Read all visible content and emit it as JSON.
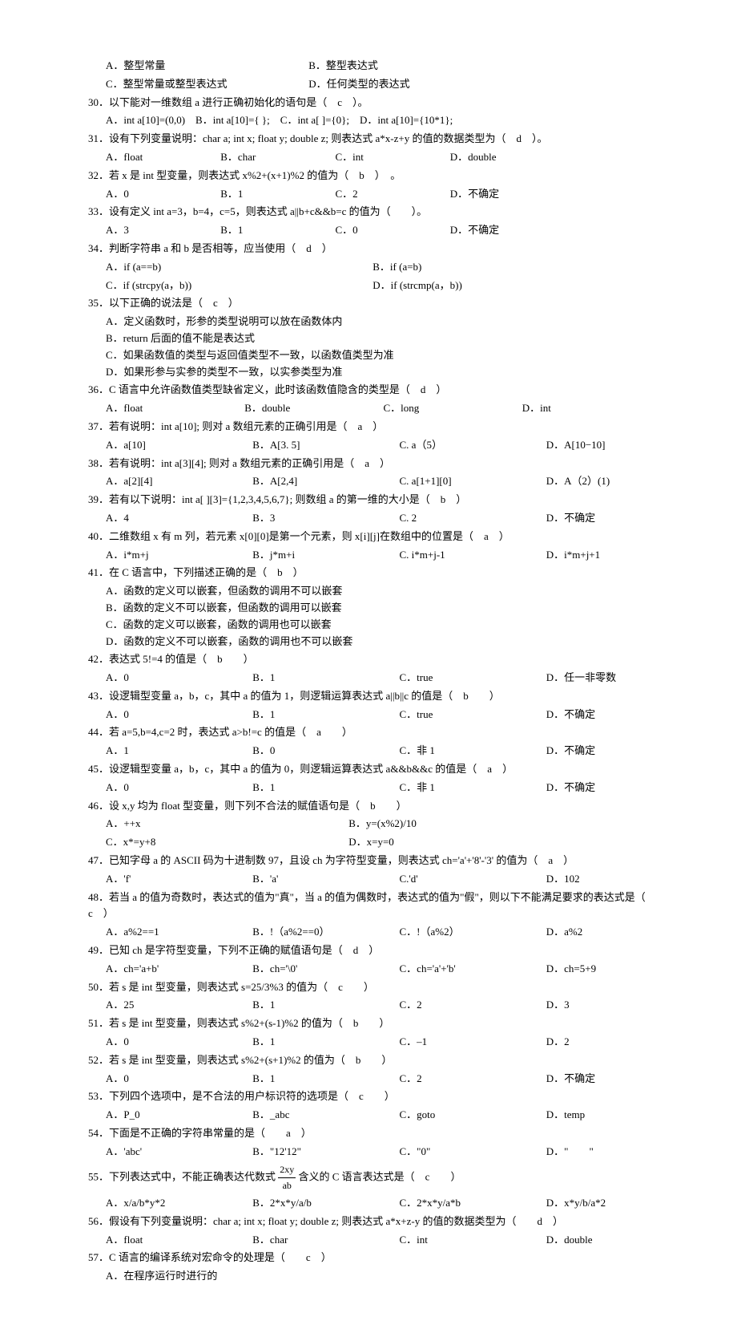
{
  "q29": {
    "optA": "A．整型常量",
    "optB": "B．整型表达式",
    "optC": "C．整型常量或整型表达式",
    "optD": "D．任何类型的表达式"
  },
  "q30": {
    "stem": "30．以下能对一维数组 a 进行正确初始化的语句是（　c　）。",
    "opts": "A．int a[10]=(0,0)　B．int a[10]={ };　C．int a[ ]={0};　D．int a[10]={10*1};"
  },
  "q31": {
    "stem": "31．设有下列变量说明：char a; int x; float y; double z;  则表达式 a*x-z+y 的值的数据类型为（　d　）。",
    "optA": "A．float",
    "optB": "B．char",
    "optC": "C．int",
    "optD": "D．double"
  },
  "q32": {
    "stem": "32．若 x 是 int 型变量，则表达式 x%2+(x+1)%2 的值为（　b　）　。",
    "optA": "A．0",
    "optB": "B．1",
    "optC": "C．2",
    "optD": "D．不确定"
  },
  "q33": {
    "stem": "33．设有定义 int a=3，b=4，c=5，则表达式 a||b+c&&b=c 的值为（　　）。",
    "optA": "A．3",
    "optB": "B．1",
    "optC": "C．0",
    "optD": "D．不确定"
  },
  "q34": {
    "stem": "34．判断字符串 a 和 b 是否相等，应当使用（　d　）",
    "optA": "A．if (a==b)",
    "optB": "B．if (a=b)",
    "optC": "C．if (strcpy(a，b))",
    "optD": "D．if (strcmp(a，b))"
  },
  "q35": {
    "stem": "35．以下正确的说法是（　c　）",
    "optA": "A．定义函数时，形参的类型说明可以放在函数体内",
    "optB": "B．return 后面的值不能是表达式",
    "optC": "C．如果函数值的类型与返回值类型不一致，以函数值类型为准",
    "optD": "D．如果形参与实参的类型不一致，以实参类型为准"
  },
  "q36": {
    "stem": "36．C 语言中允许函数值类型缺省定义，此时该函数值隐含的类型是（　d　）",
    "optA": "A．float",
    "optB": "B．double",
    "optC": "C．long",
    "optD": "D．int"
  },
  "q37": {
    "stem": "37．若有说明：int a[10];  则对 a 数组元素的正确引用是（　a　）",
    "optA": "A．a[10]",
    "optB": "B．A[3. 5]",
    "optC": "C. a（5）",
    "optD": "D．A[10−10]"
  },
  "q38": {
    "stem": "38．若有说明：int a[3][4];  则对 a 数组元素的正确引用是（　a　）",
    "optA": "A．a[2][4]",
    "optB": "B．A[2,4]",
    "optC": "C. a[1+1][0]",
    "optD": "D．A（2）(1)"
  },
  "q39": {
    "stem": "39．若有以下说明：int a[ ][3]={1,2,3,4,5,6,7};  则数组 a 的第一维的大小是（　b　）",
    "optA": "A．4",
    "optB": "B．3",
    "optC": "C. 2",
    "optD": "D．不确定"
  },
  "q40": {
    "stem": "40．二维数组 x 有 m 列，若元素 x[0][0]是第一个元素，则 x[i][j]在数组中的位置是（　a　）",
    "optA": "A．i*m+j",
    "optB": "B．j*m+i",
    "optC": "C. i*m+j-1",
    "optD": "D．i*m+j+1"
  },
  "q41": {
    "stem": "41．在 C 语言中，下列描述正确的是（　b　）",
    "optA": "A．函数的定义可以嵌套，但函数的调用不可以嵌套",
    "optB": "B．函数的定义不可以嵌套，但函数的调用可以嵌套",
    "optC": "C．函数的定义可以嵌套，函数的调用也可以嵌套",
    "optD": "D．函数的定义不可以嵌套，函数的调用也不可以嵌套"
  },
  "q42": {
    "stem": "42．表达式 5!=4 的值是（　b　　）",
    "optA": "A．0",
    "optB": "B．1",
    "optC": "C．true",
    "optD": "D．任一非零数"
  },
  "q43": {
    "stem": "43．设逻辑型变量 a，b，c，其中 a 的值为 1，则逻辑运算表达式 a||b||c 的值是（　b　　）",
    "optA": "A．0",
    "optB": "B．1",
    "optC": "C．true",
    "optD": "D．不确定"
  },
  "q44": {
    "stem": "44．若 a=5,b=4,c=2 时，表达式 a>b!=c 的值是（　a　　）",
    "optA": "A．1",
    "optB": "B．0",
    "optC": "C．非 1",
    "optD": "D．不确定"
  },
  "q45": {
    "stem": "45．设逻辑型变量 a，b，c，其中 a 的值为 0，则逻辑运算表达式 a&&b&&c 的值是（　a　）",
    "optA": "A．0",
    "optB": "B．1",
    "optC": "C．非 1",
    "optD": "D．不确定"
  },
  "q46": {
    "stem": "46．设 x,y 均为 float 型变量，则下列不合法的赋值语句是（　b　　）",
    "optA": "A．++x",
    "optB": "B．y=(x%2)/10",
    "optC": "C．x*=y+8",
    "optD": "D．x=y=0"
  },
  "q47": {
    "stem": "47．已知字母 a 的 ASCII 码为十进制数 97，且设 ch 为字符型变量，则表达式 ch='a'+'8'-'3' 的值为（　a　）",
    "optA": "A．'f'",
    "optB": "B．'a'",
    "optC": "C.'d'",
    "optD": "D．102"
  },
  "q48": {
    "stem": "48．若当 a 的值为奇数时，表达式的值为\"真\"，当 a 的值为偶数时，表达式的值为\"假\"，则以下不能满足要求的表达式是（　c　）",
    "optA": "A．a%2==1",
    "optB": "B．!（a%2==0）",
    "optC": "C．!（a%2）",
    "optD": "D．a%2"
  },
  "q49": {
    "stem": "49．已知 ch 是字符型变量，下列不正确的赋值语句是（　d　）",
    "optA": "A．ch='a+b'",
    "optB": "B．ch='\\0'",
    "optC": "C．ch='a'+'b'",
    "optD": "D．ch=5+9"
  },
  "q50": {
    "stem": "50．若 s 是 int 型变量，则表达式 s=25/3%3 的值为（　c　　）",
    "optA": "A．25",
    "optB": "B．1",
    "optC": "C．2",
    "optD": "D．3"
  },
  "q51": {
    "stem": "51．若 s 是 int 型变量，则表达式 s%2+(s-1)%2 的值为（　b　　）",
    "optA": "A．0",
    "optB": "B．1",
    "optC": "C．–1",
    "optD": "D．2"
  },
  "q52": {
    "stem": "52．若 s 是 int 型变量，则表达式 s%2+(s+1)%2 的值为（　b　　）",
    "optA": "A．0",
    "optB": "B．1",
    "optC": "C．2",
    "optD": "D．不确定"
  },
  "q53": {
    "stem": "53．下列四个选项中，是不合法的用户标识符的选项是（　c　　）",
    "optA": "A．P_0",
    "optB": "B．_abc",
    "optC": "C．goto",
    "optD": "D．temp"
  },
  "q54": {
    "stem": "54．下面是不正确的字符串常量的是（　　a　）",
    "optA": "A．'abc'",
    "optB": "B．\"12'12\"",
    "optC": "C．\"0\"",
    "optD": "D．\"　　\""
  },
  "q55": {
    "stemPre": "55．下列表达式中，不能正确表达代数式 ",
    "fracN": "2xy",
    "fracD": "ab",
    "stemPost": " 含义的 C 语言表达式是（　c　　）",
    "optA": "A．x/a/b*y*2",
    "optB": "B．2*x*y/a/b",
    "optC": "C．2*x*y/a*b",
    "optD": "D．x*y/b/a*2"
  },
  "q56": {
    "stem": "56．假设有下列变量说明：char a; int x; float y; double z;  则表达式 a*x+z-y 的值的数据类型为（　　d　）",
    "optA": "A．float",
    "optB": "B．char",
    "optC": "C．int",
    "optD": "D．double"
  },
  "q57": {
    "stem": "57．C 语言的编译系统对宏命令的处理是（　　c　）",
    "optA": "A．在程序运行时进行的"
  }
}
